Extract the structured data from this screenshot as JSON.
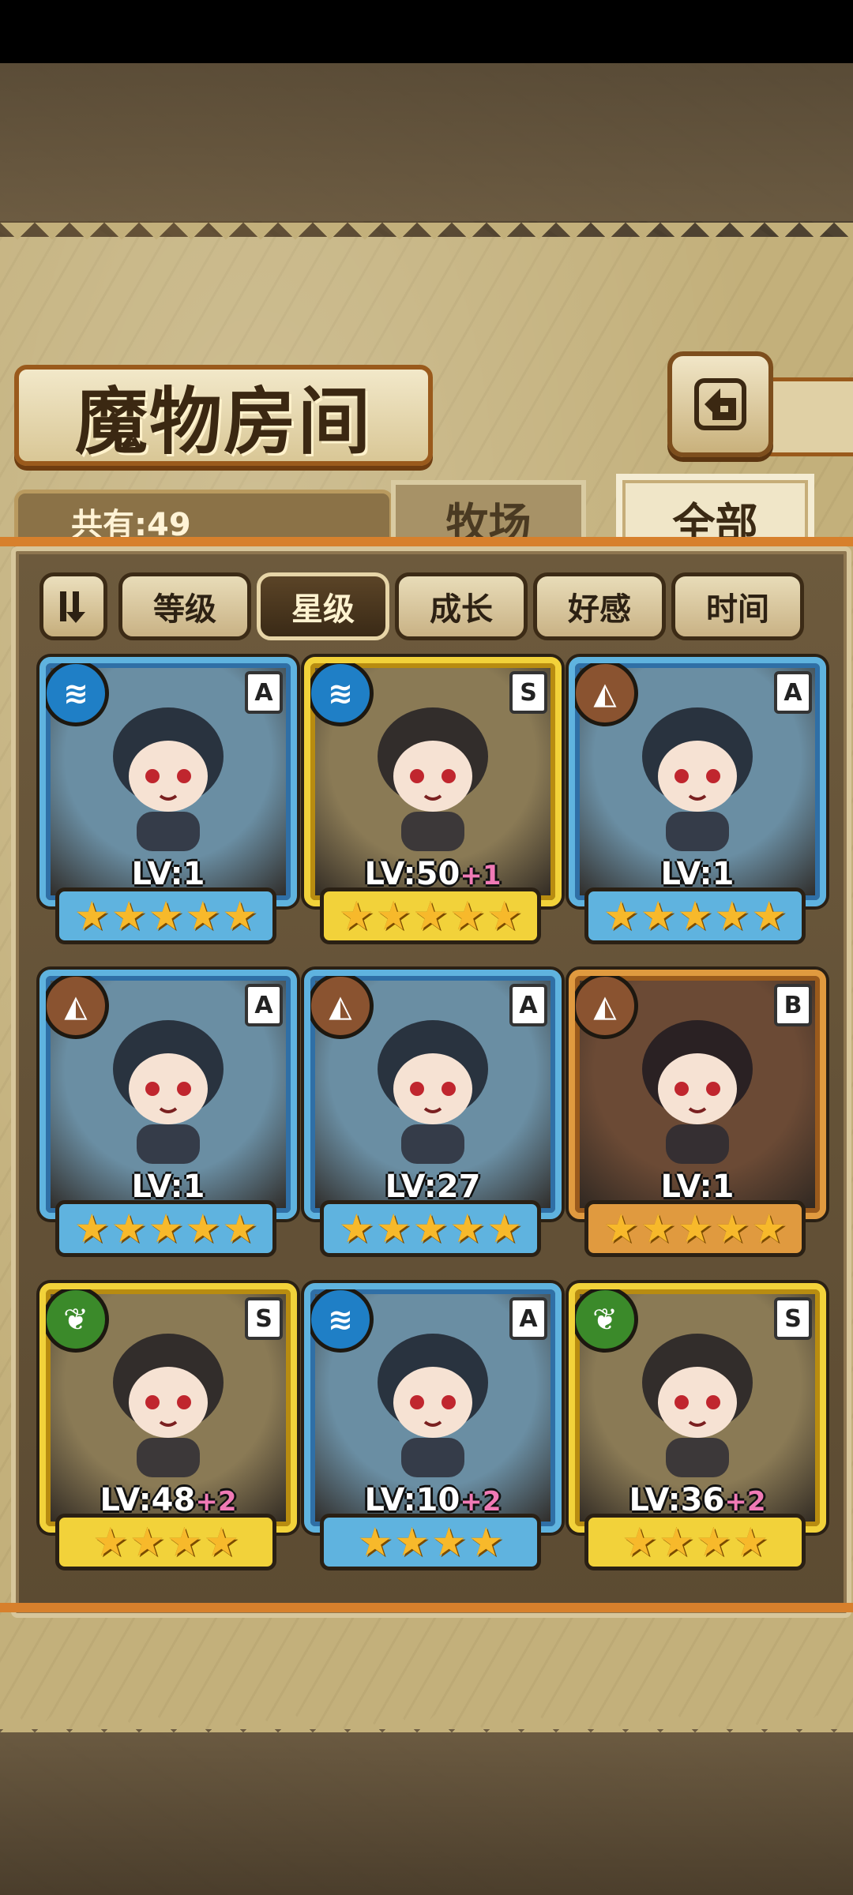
{
  "title": "魔物房间",
  "count_label": "共有:49",
  "tabs": [
    {
      "label": "牧场",
      "active": false
    },
    {
      "label": "全部",
      "active": true
    }
  ],
  "sort_filters": [
    {
      "label": "等级",
      "active": false
    },
    {
      "label": "星级",
      "active": true
    },
    {
      "label": "成长",
      "active": false
    },
    {
      "label": "好感",
      "active": false
    },
    {
      "label": "时间",
      "active": false
    }
  ],
  "monsters": [
    {
      "element": "water",
      "grade": "A",
      "level": "LV:1",
      "bonus": "",
      "stars": 5,
      "frame": "blue"
    },
    {
      "element": "water",
      "grade": "S",
      "level": "LV:50",
      "bonus": "+1",
      "stars": 5,
      "frame": "gold"
    },
    {
      "element": "earth",
      "grade": "A",
      "level": "LV:1",
      "bonus": "",
      "stars": 5,
      "frame": "blue"
    },
    {
      "element": "earth",
      "grade": "A",
      "level": "LV:1",
      "bonus": "",
      "stars": 5,
      "frame": "blue"
    },
    {
      "element": "earth",
      "grade": "A",
      "level": "LV:27",
      "bonus": "",
      "stars": 5,
      "frame": "blue"
    },
    {
      "element": "earth",
      "grade": "B",
      "level": "LV:1",
      "bonus": "",
      "stars": 5,
      "frame": "bronze"
    },
    {
      "element": "wood",
      "grade": "S",
      "level": "LV:48",
      "bonus": "+2",
      "stars": 4,
      "frame": "gold"
    },
    {
      "element": "water",
      "grade": "A",
      "level": "LV:10",
      "bonus": "+2",
      "stars": 4,
      "frame": "blue"
    },
    {
      "element": "wood",
      "grade": "S",
      "level": "LV:36",
      "bonus": "+2",
      "stars": 4,
      "frame": "gold"
    }
  ],
  "colors": {
    "water": "#1f7fc6",
    "earth": "#8a5330",
    "wood": "#3b8a2a"
  }
}
